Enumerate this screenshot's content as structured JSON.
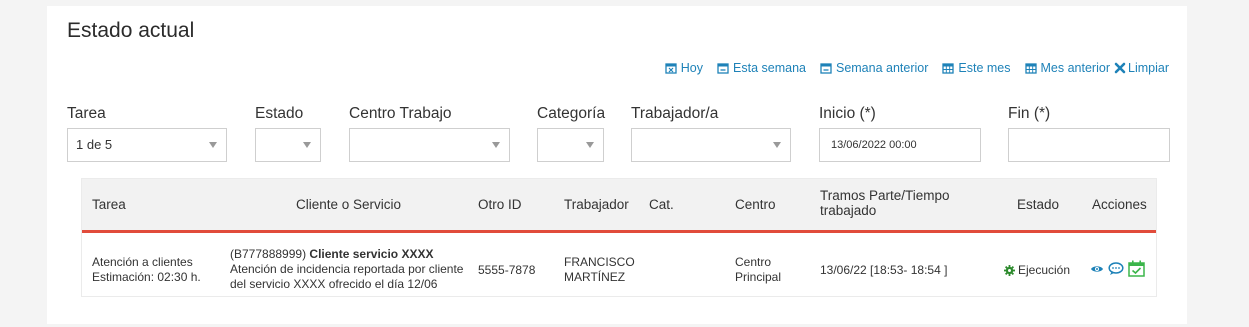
{
  "title": "Estado actual",
  "quick_filters": [
    {
      "label": "Hoy",
      "icon": "calendar-x-icon"
    },
    {
      "label": "Esta semana",
      "icon": "calendar-minus-icon"
    },
    {
      "label": "Semana anterior",
      "icon": "calendar-minus-icon"
    },
    {
      "label": "Este mes",
      "icon": "calendar-grid-icon"
    },
    {
      "label": "Mes anterior",
      "icon": "calendar-grid-icon"
    },
    {
      "label": "Limpiar",
      "icon": "x-icon"
    }
  ],
  "filters": {
    "tarea": {
      "label": "Tarea",
      "value": "1 de 5"
    },
    "estado": {
      "label": "Estado",
      "value": ""
    },
    "centro": {
      "label": "Centro Trabajo",
      "value": ""
    },
    "categoria": {
      "label": "Categoría",
      "value": ""
    },
    "trabajador": {
      "label": "Trabajador/a",
      "value": ""
    },
    "inicio": {
      "label": "Inicio (*)",
      "value": "13/06/2022 00:00"
    },
    "fin": {
      "label": "Fin (*)",
      "value": ""
    }
  },
  "table": {
    "headers": {
      "tarea": "Tarea",
      "cliente": "Cliente o Servicio",
      "otro_id": "Otro ID",
      "trabajador": "Trabajador",
      "cat": "Cat.",
      "centro": "Centro",
      "tramos_1": "Tramos Parte/Tiempo",
      "tramos_2": "trabajado",
      "estado": "Estado",
      "acciones": "Acciones"
    },
    "rows": [
      {
        "tarea_1": "Atención a clientes",
        "tarea_2": "Estimación: 02:30 h.",
        "cliente_code": "(B777888999)",
        "cliente_name": "Cliente servicio XXXX",
        "cliente_desc_1": "Atención de incidencia reportada por cliente",
        "cliente_desc_2": "del servicio XXXX ofrecido el día 12/06",
        "otro_id": "5555-7878",
        "trabajador_1": "FRANCISCO",
        "trabajador_2": "MARTÍNEZ",
        "cat": "",
        "centro_1": "Centro",
        "centro_2": "Principal",
        "tramos": "13/06/22 [18:53- 18:54 ]",
        "estado": "Ejecución",
        "actions": [
          "eye-icon",
          "comment-icon",
          "calendar-check-icon"
        ]
      }
    ]
  },
  "colors": {
    "link": "#1e82b8",
    "accent_red": "#e14b3b",
    "status_green": "#2e8b2e",
    "action_green": "#3bb54a"
  }
}
